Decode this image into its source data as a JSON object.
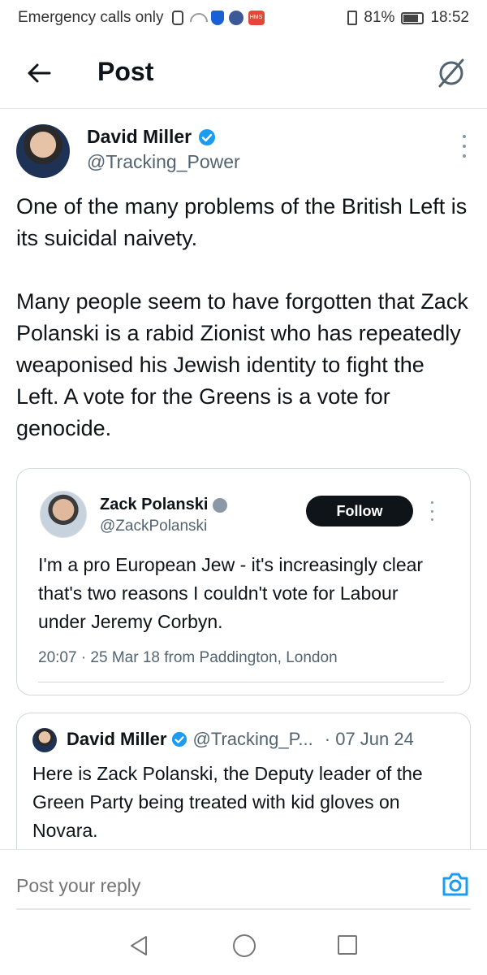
{
  "status_bar": {
    "carrier_text": "Emergency calls only",
    "battery": "81%",
    "time": "18:52",
    "icons": [
      "sim-icon",
      "wifi-icon",
      "shield-icon",
      "facebook-icon",
      "hms-icon",
      "vibrate-icon",
      "battery-icon"
    ],
    "hms_label": "HMS"
  },
  "header": {
    "title": "Post",
    "back_icon": "arrow-left-icon",
    "grok_icon": "grok-icon"
  },
  "tweet": {
    "author_name": "David Miller",
    "author_handle": "@Tracking_Power",
    "text": "One of the many problems of the British Left is its suicidal naivety.\n\nMany people seem to have forgotten that Zack Polanski is a rabid Zionist who has repeatedly weaponised his Jewish identity to fight the Left. A vote for the Greens is a vote for genocide.",
    "accent_color": "#1d9bf0"
  },
  "quoted_image": {
    "author_name": "Zack Polanski",
    "author_handle": "@ZackPolanski",
    "follow_label": "Follow",
    "text": "I'm a pro European Jew - it's increasingly clear that's two reasons I couldn't vote for Labour under Jeremy Corbyn.",
    "meta": "20:07 · 25 Mar 18 from Paddington, London"
  },
  "quoted_tweet": {
    "author_name": "David Miller",
    "author_handle": "@Tracking_P...",
    "date": "· 07 Jun 24",
    "text": "Here is Zack Polanski, the Deputy leader of the Green Party being treated with kid gloves on Novara."
  },
  "reply": {
    "placeholder": "Post your reply",
    "camera_icon": "camera-icon",
    "icon_color": "#1d9bf0"
  },
  "nav_bar": {
    "icons": [
      "nav-back-icon",
      "nav-home-icon",
      "nav-recents-icon"
    ]
  }
}
